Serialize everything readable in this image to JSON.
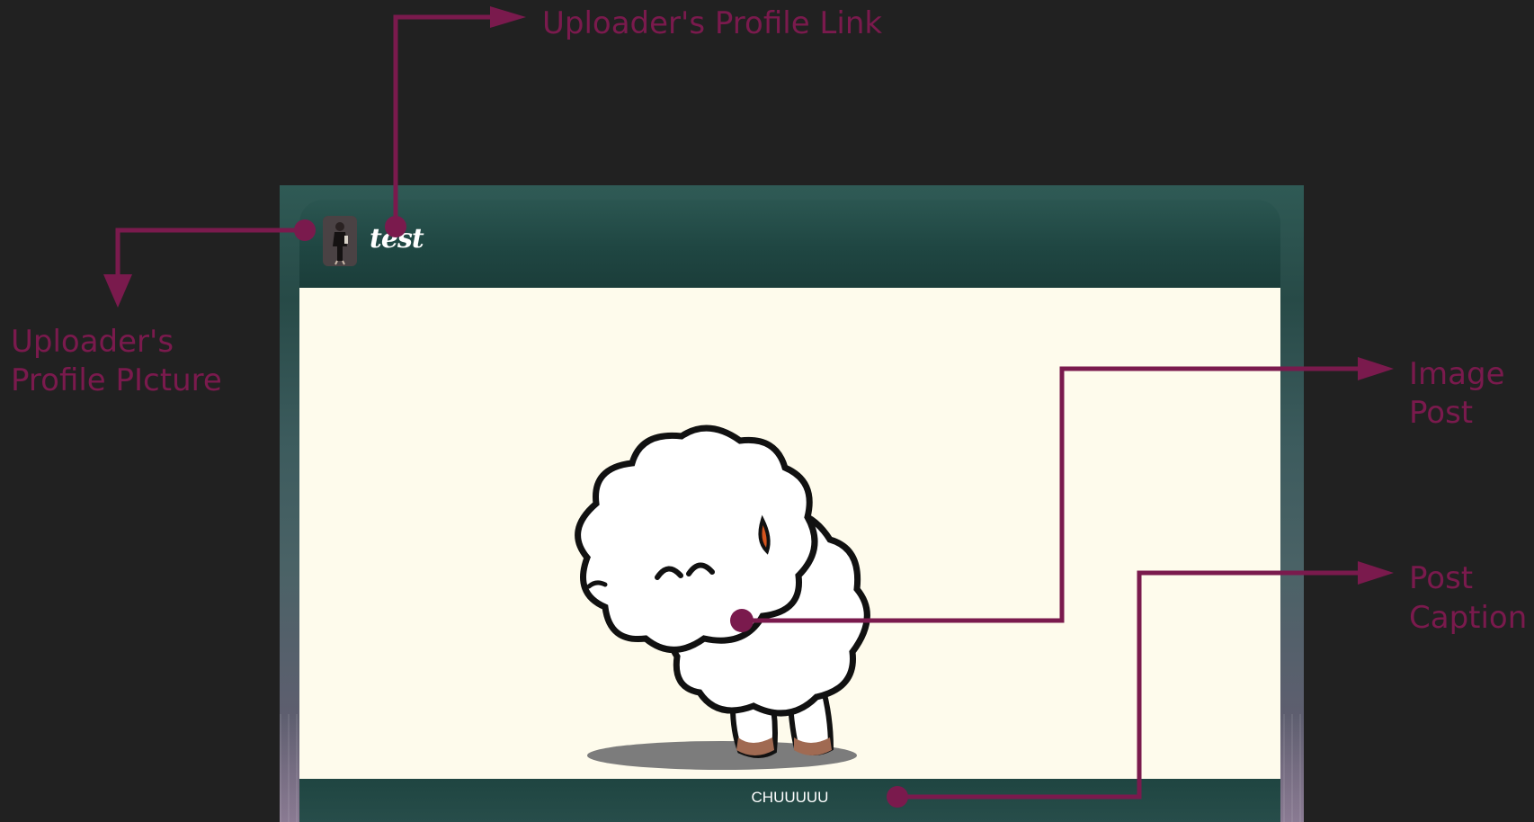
{
  "annotations": {
    "profile_link": "Uploader's Profile Link",
    "profile_picture_line1": "Uploader's",
    "profile_picture_line2": "Profile PIcture",
    "image_post_line1": "Image",
    "image_post_line2": "Post",
    "post_caption_line1": "Post",
    "post_caption_line2": "Caption"
  },
  "post": {
    "username": "test",
    "caption": "CHUUUUU"
  },
  "colors": {
    "annotation": "#7a1a4d",
    "background": "#212121",
    "image_background": "#fefbec",
    "header": "#1f4642"
  },
  "icons": {
    "avatar": "user-avatar-icon",
    "post_image": "sheep-illustration"
  }
}
